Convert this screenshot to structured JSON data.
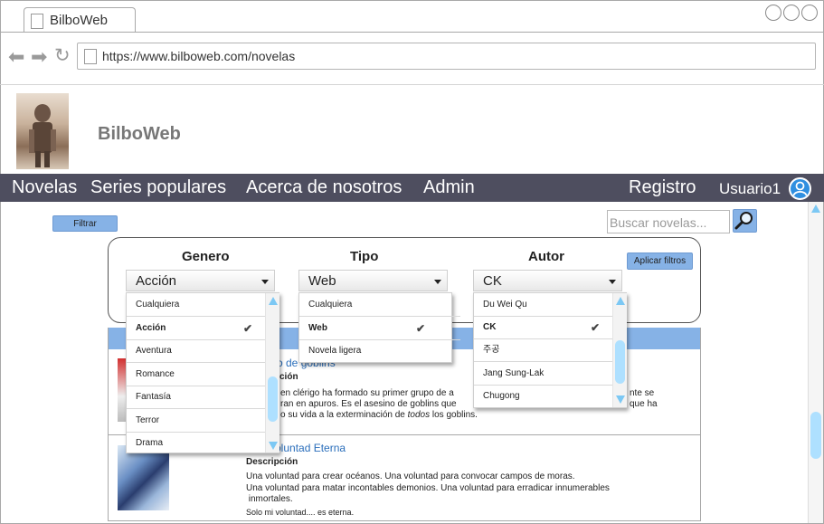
{
  "browser": {
    "tab_title": "BilboWeb",
    "url": "https://www.bilboweb.com/novelas"
  },
  "site": {
    "title": "BilboWeb"
  },
  "nav": {
    "items": [
      "Novelas",
      "Series populares",
      "Acerca de nosotros",
      "Admin"
    ],
    "register": "Registro",
    "user": "Usuario1"
  },
  "toolbar": {
    "filter_button": "Filtrar",
    "search_placeholder": "Buscar novelas..."
  },
  "filters": {
    "apply_button": "Aplicar filtros",
    "genero": {
      "label": "Genero",
      "selected": "Acción",
      "options": [
        "Cualquiera",
        "Acción",
        "Aventura",
        "Romance",
        "Fantasía",
        "Terror",
        "Drama"
      ]
    },
    "tipo": {
      "label": "Tipo",
      "selected": "Web",
      "options": [
        "Cualquiera",
        "Web",
        "Novela ligera"
      ]
    },
    "autor": {
      "label": "Autor",
      "selected": "CK",
      "options": [
        "Du Wei Qu",
        "CK",
        "주공",
        "Jang Sung-Lak",
        "Chugong"
      ]
    }
  },
  "novels": [
    {
      "title_visible": "o de goblins",
      "desc_label_visible": "ción",
      "lines_visible": [
        "en clérigo ha formado su primer grupo de a",
        "ran en apuros. Es el asesino de goblins que",
        "o su vida a la exterminación de "
      ],
      "lines_visible_right": [
        "nte se",
        "que ha"
      ],
      "emphasis": "todos",
      "line_end": " los goblins."
    },
    {
      "title_visible": "oluntad Eterna",
      "desc_label": "Descripción",
      "lines": [
        "Una voluntad para crear océanos. Una voluntad para convocar campos de moras.",
        "Una voluntad para matar incontables demonios. Una voluntad para erradicar innumerables",
        " inmortales.",
        "Solo mi voluntad.... es eterna."
      ]
    }
  ],
  "colors": {
    "navbar": "#4e4e5f",
    "accent": "#86b2e6",
    "link": "#2a6ebb",
    "scroll": "#aee0ff"
  }
}
